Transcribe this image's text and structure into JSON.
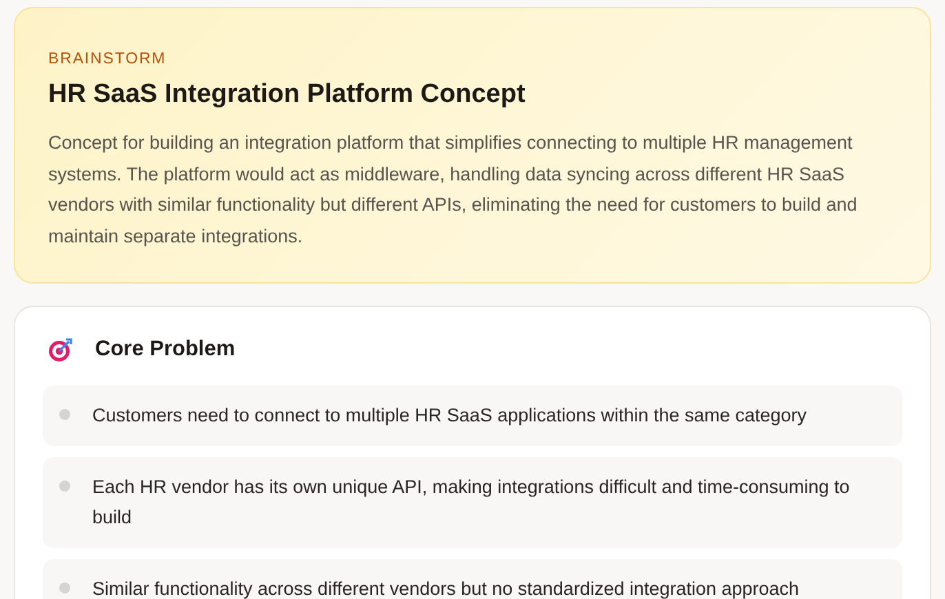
{
  "header": {
    "kicker": "BRAINSTORM",
    "title": "HR SaaS Integration Platform Concept",
    "description": "Concept for building an integration platform that simplifies connecting to multiple HR management systems. The platform would act as middleware, handling data syncing across different HR SaaS vendors with similar functionality but different APIs, eliminating the need for customers to build and maintain separate integrations."
  },
  "section": {
    "title": "Core Problem",
    "items": [
      "Customers need to connect to multiple HR SaaS applications within the same category",
      "Each HR vendor has its own unique API, making integrations difficult and time-consuming to build",
      "Similar functionality across different vendors but no standardized integration approach"
    ]
  }
}
